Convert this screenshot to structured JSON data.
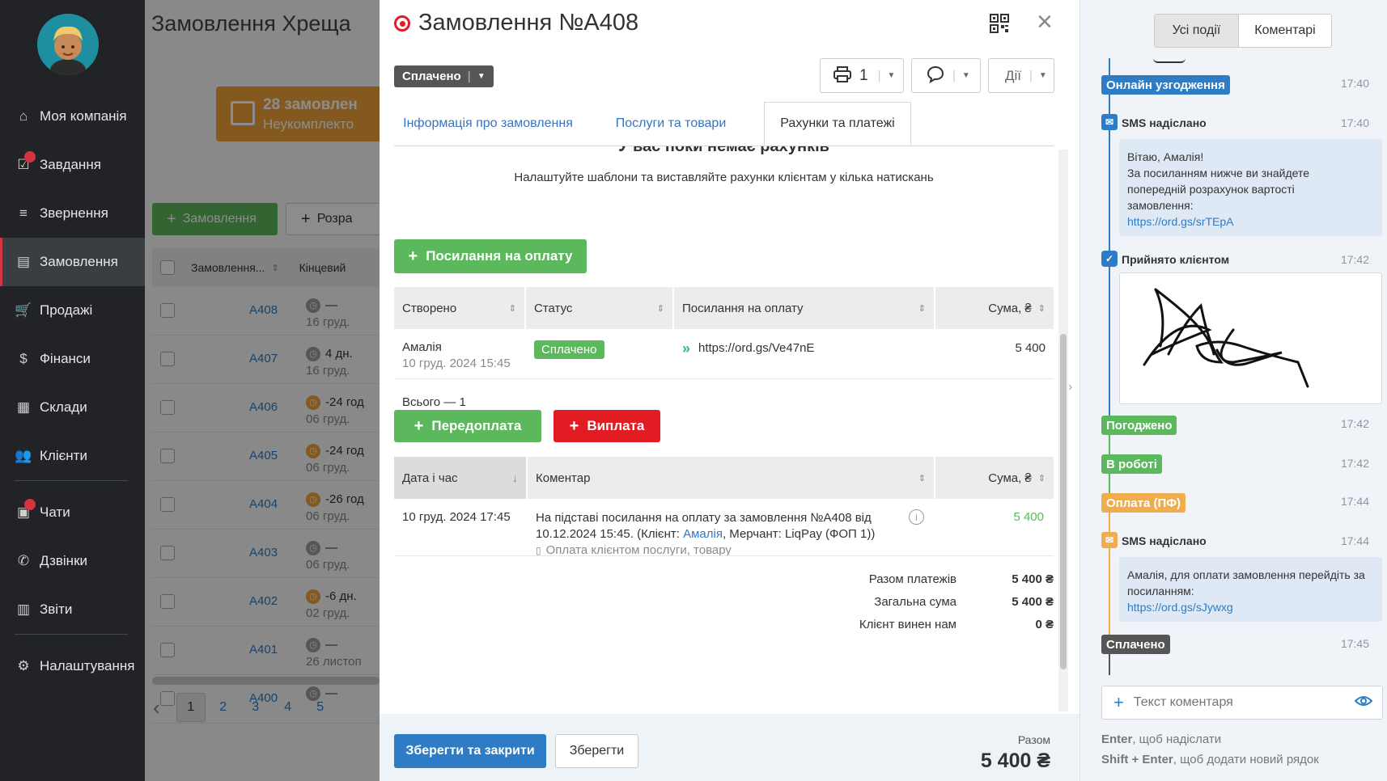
{
  "sidebar": {
    "items": [
      {
        "label": "Моя компанія",
        "icon": "home-icon"
      },
      {
        "label": "Завдання",
        "icon": "tasks-icon",
        "badge": "1"
      },
      {
        "label": "Звернення",
        "icon": "filter-icon"
      },
      {
        "label": "Замовлення",
        "icon": "orders-icon",
        "active": true
      },
      {
        "label": "Продажі",
        "icon": "cart-icon"
      },
      {
        "label": "Фінанси",
        "icon": "dollar-icon"
      },
      {
        "label": "Склади",
        "icon": "warehouse-icon"
      },
      {
        "label": "Клієнти",
        "icon": "users-icon"
      },
      {
        "label": "Чати",
        "icon": "chat-icon",
        "badge": "9+"
      },
      {
        "label": "Дзвінки",
        "icon": "phone-icon"
      },
      {
        "label": "Звіти",
        "icon": "reports-icon"
      },
      {
        "label": "Налаштування",
        "icon": "gear-icon"
      }
    ]
  },
  "background": {
    "title": "Замовлення Хреща",
    "banner_count": "28 замовлен",
    "banner_sub": "Неукомплекто",
    "new_order_btn": "Замовлення",
    "calc_btn": "Розра",
    "col_order": "Замовлення...",
    "col_deadline": "Кінцевий",
    "rows": [
      {
        "id": "A408",
        "time": "—",
        "date": "16 груд."
      },
      {
        "id": "A407",
        "time": "4 дн.",
        "date": "16 груд."
      },
      {
        "id": "A406",
        "time": "-24 год",
        "date": "06 груд."
      },
      {
        "id": "A405",
        "time": "-24 год",
        "date": "06 груд."
      },
      {
        "id": "A404",
        "time": "-26 год",
        "date": "06 груд."
      },
      {
        "id": "A403",
        "time": "—",
        "date": "06 груд."
      },
      {
        "id": "A402",
        "time": "-6 дн.",
        "date": "02 груд."
      },
      {
        "id": "A401",
        "time": "—",
        "date": "26 листоп"
      },
      {
        "id": "A400",
        "time": "—",
        "date": ""
      }
    ],
    "pages": [
      "1",
      "2",
      "3",
      "4",
      "5"
    ]
  },
  "modal": {
    "title": "Замовлення №A408",
    "status": "Сплачено",
    "print_count": "1",
    "actions_label": "Дії",
    "tabs": [
      "Інформація про замовлення",
      "Послуги та товари",
      "Рахунки та платежі"
    ],
    "empty_title": "У вас поки немає рахунків",
    "empty_sub": "Налаштуйте шаблони та виставляйте рахунки клієнтам у кілька натискань",
    "pay_link_btn": "Посилання на оплату",
    "links_table": {
      "headers": [
        "Створено",
        "Статус",
        "Посилання на оплату",
        "Сума, ₴"
      ],
      "row": {
        "name": "Амалія",
        "date": "10 груд. 2024 15:45",
        "status": "Сплачено",
        "url": "https://ord.gs/Ve47nE",
        "sum": "5 400"
      },
      "total": "Всього — 1"
    },
    "prepay_btn": "Передоплата",
    "payout_btn": "Виплата",
    "pay_table": {
      "headers": [
        "Дата і час",
        "Коментар",
        "Сума, ₴"
      ],
      "row": {
        "date": "10 груд. 2024 17:45",
        "comment_1": "На підставі посилання на оплату за замовлення №A408 від",
        "comment_2a": "10.12.2024 15:45.  (Клієнт: ",
        "client": "Амалія",
        "comment_2b": ", Мерчант: LiqPay (ФОП 1))",
        "comment_3": "Оплата клієнтом послуги, товару",
        "sum": "5 400"
      }
    },
    "summary": [
      {
        "label": "Разом платежів",
        "value": "5 400 ₴"
      },
      {
        "label": "Загальна сума",
        "value": "5 400 ₴"
      },
      {
        "label": "Клієнт винен нам",
        "value": "0 ₴"
      }
    ],
    "save_close_btn": "Зберегти та закрити",
    "save_btn": "Зберегти",
    "total_label": "Разом",
    "total_value": "5 400 ₴"
  },
  "events": {
    "tabs": [
      "Усі події",
      "Коментарі"
    ],
    "items": [
      {
        "type": "pill",
        "label": "Онлайн узгодження",
        "time": "17:40",
        "color": "#2d7cc5"
      },
      {
        "type": "sms",
        "label": "SMS надіслано",
        "time": "17:40",
        "lines": [
          "Вітаю, Амалія!",
          "За посиланням нижче ви знайдете",
          "попередній розрахунок вартості",
          "замовлення:"
        ],
        "link": "https://ord.gs/srTEpA"
      },
      {
        "type": "accepted",
        "label": "Прийнято клієнтом",
        "time": "17:42"
      },
      {
        "type": "pill",
        "label": "Погоджено",
        "time": "17:42",
        "color": "#5cb85c"
      },
      {
        "type": "pill",
        "label": "В роботі",
        "time": "17:42",
        "color": "#5cb85c"
      },
      {
        "type": "pill",
        "label": "Оплата (ПФ)",
        "time": "17:44",
        "color": "#f0ad4e"
      },
      {
        "type": "sms",
        "label": "SMS надіслано",
        "time": "17:44",
        "lines": [
          "Амалія, для оплати замовлення перейдіть за",
          "посиланням:"
        ],
        "link": "https://ord.gs/sJywxg"
      },
      {
        "type": "pill",
        "label": "Сплачено",
        "time": "17:45",
        "color": "#555555"
      }
    ],
    "comment_placeholder": "Текст коментаря",
    "hint_enter_key": "Enter",
    "hint_enter": ", щоб надіслати",
    "hint_shift_key": "Shift + Enter",
    "hint_shift": ", щоб додати новий рядок"
  }
}
